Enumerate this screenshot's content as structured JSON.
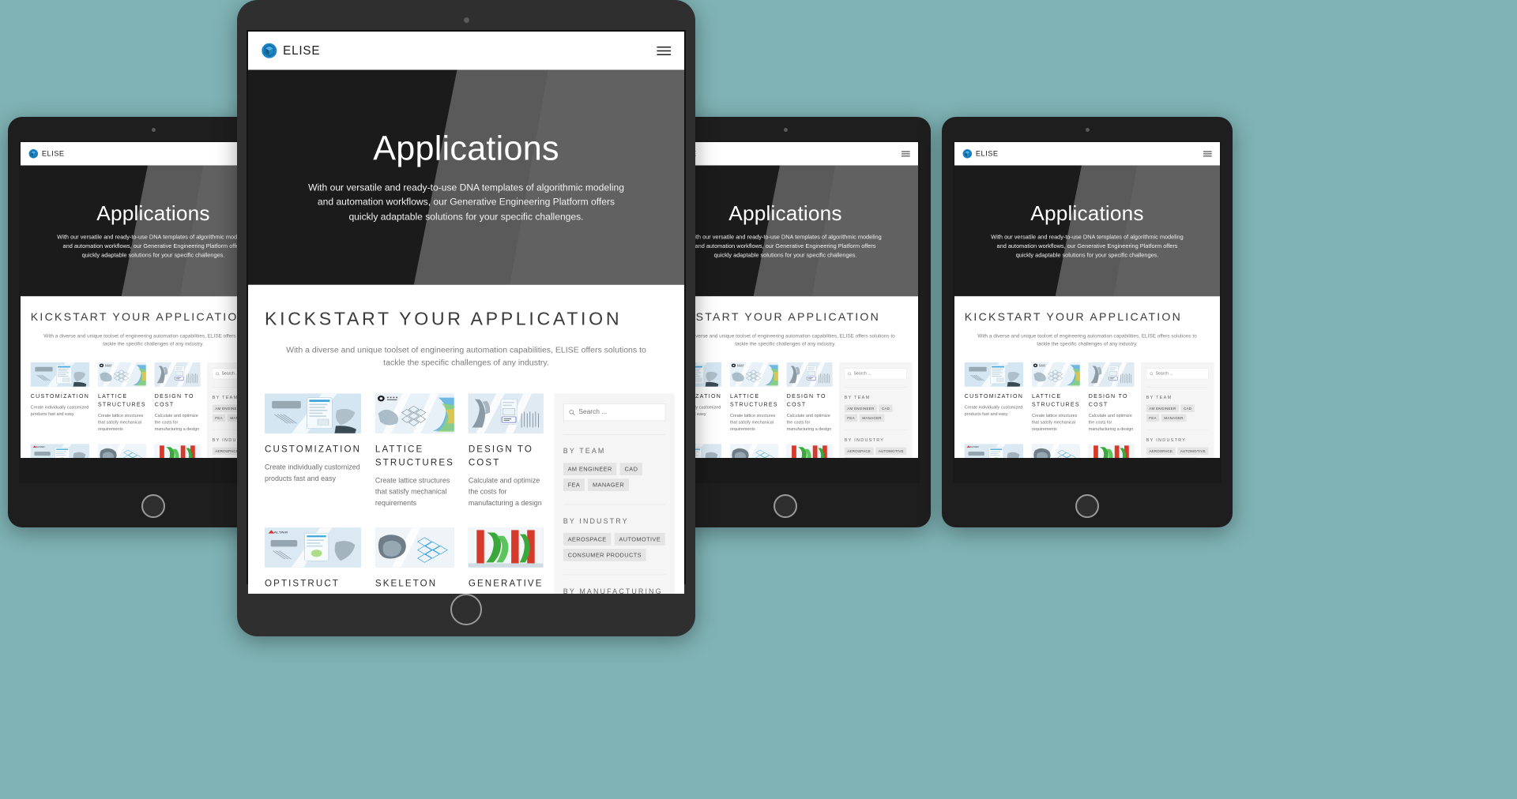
{
  "brand": {
    "name": "ELISE",
    "logo_icon": "elise-cube-logo-icon"
  },
  "nav": {
    "menu_icon": "hamburger-menu-icon"
  },
  "hero": {
    "title": "Applications",
    "subtitle": "With our versatile and ready-to-use DNA templates of algorithmic modeling and automation workflows, our Generative Engineering Platform offers quickly adaptable solutions for your specific challenges."
  },
  "main": {
    "section_title": "KICKSTART YOUR APPLICATION",
    "section_desc": "With a diverse and unique toolset of engineering automation capabilities, ELISE offers solutions to tackle the specific challenges of any industry."
  },
  "cards": [
    {
      "title": "CUSTOMIZATION",
      "desc": "Create individually customized products fast and easy",
      "thumb": "customization-thumbnail"
    },
    {
      "title": "LATTICE STRUCTURES",
      "desc": "Create lattice structures that satisfy mechanical requirements",
      "thumb": "lattice-structures-thumbnail"
    },
    {
      "title": "DESIGN TO COST",
      "desc": "Calculate and optimize the costs for manufacturing a design",
      "thumb": "design-to-cost-thumbnail"
    },
    {
      "title": "OPTISTRUCT",
      "desc": "",
      "thumb": "optistruct-thumbnail"
    },
    {
      "title": "SKELETON",
      "desc": "",
      "thumb": "skeleton-thumbnail"
    },
    {
      "title": "GENERATIVE",
      "desc": "",
      "thumb": "generative-thumbnail"
    }
  ],
  "sidebar": {
    "search": {
      "placeholder": "Search ...",
      "value": "",
      "icon": "search-icon"
    },
    "groups": [
      {
        "heading": "BY TEAM",
        "tags": [
          "AM ENGINEER",
          "CAD",
          "FEA",
          "MANAGER"
        ]
      },
      {
        "heading": "BY INDUSTRY",
        "tags": [
          "AEROSPACE",
          "AUTOMOTIVE",
          "CONSUMER PRODUCTS"
        ]
      },
      {
        "heading": "BY MANUFACTURING TECHNIQUE",
        "tags": []
      }
    ]
  },
  "colors": {
    "background": "#7fb3b5",
    "hero_dark": "#1b1b1b",
    "hero_gray": "#5a5a5a",
    "brand_blue": "#1b87c9",
    "tag_bg": "#e4e4e4",
    "sidebar_bg": "#f5f5f5"
  }
}
